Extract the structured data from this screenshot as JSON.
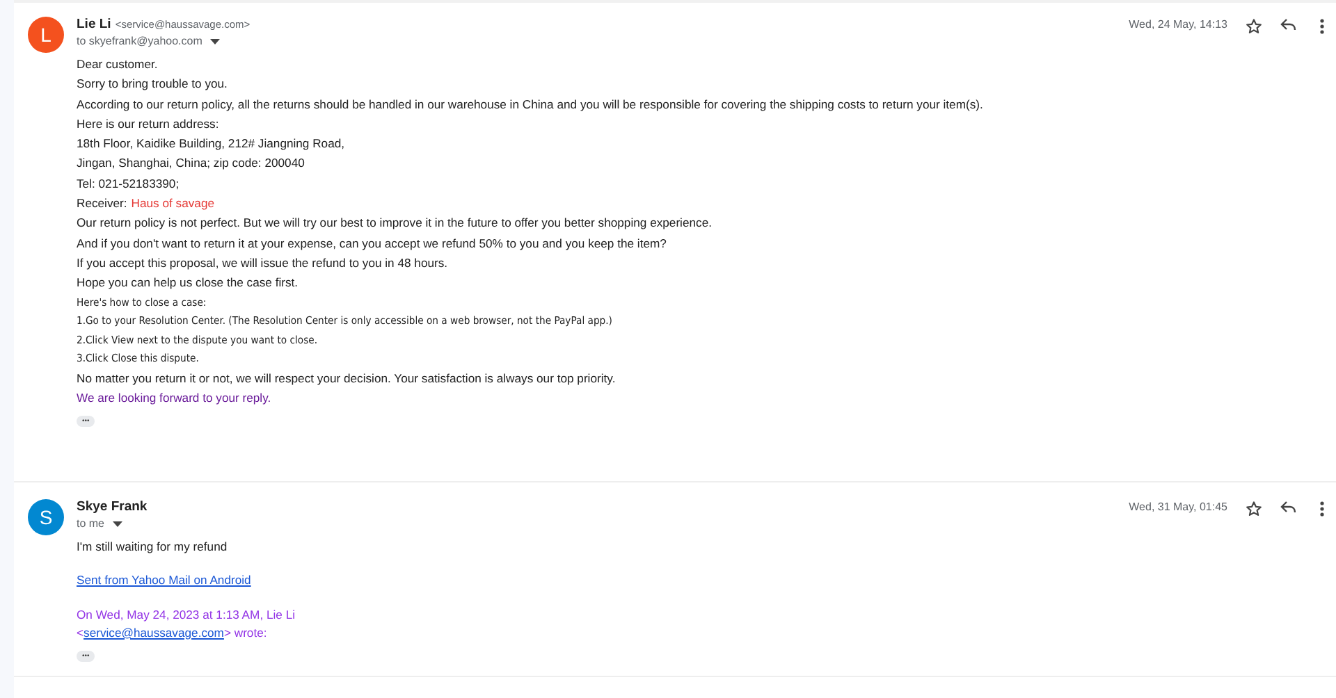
{
  "messages": [
    {
      "avatar": {
        "letter": "L",
        "color": "#f4511e"
      },
      "sender": "Lie Li",
      "email": "<service@haussavage.com>",
      "recipient": "to skyefrank@yahoo.com",
      "date": "Wed, 24 May, 14:13",
      "body": [
        {
          "kind": "text",
          "text": "Dear customer."
        },
        {
          "kind": "text",
          "text": "Sorry to bring trouble to you."
        },
        {
          "kind": "text",
          "text": "According to our return policy, all the returns should be handled in our warehouse in China and you will be responsible for covering the shipping costs to return your item(s)."
        },
        {
          "kind": "text",
          "text": "Here is our return address:"
        },
        {
          "kind": "text",
          "text": "18th Floor, Kaidike Building, 212# Jiangning Road,"
        },
        {
          "kind": "text",
          "text": "Jingan, Shanghai, China; zip code: 200040"
        },
        {
          "kind": "text",
          "text": "Tel: 021-52183390;"
        },
        {
          "kind": "labelled",
          "text": "Receiver:",
          "value": "Haus of savage"
        },
        {
          "kind": "text",
          "text": "Our return policy is not perfect. But we will try our best to improve it in the future to offer you better shopping experience."
        },
        {
          "kind": "text",
          "text": "And if you don't want to return it at your expense, can you accept we refund 50% to you and you keep the item?"
        },
        {
          "kind": "text",
          "text": "If you accept this proposal, we will issue the refund to you in 48 hours."
        },
        {
          "kind": "text",
          "text": "Hope you can help us close the case first."
        },
        {
          "kind": "small",
          "text": "Here's how to close a case:"
        },
        {
          "kind": "small",
          "text": "1.Go to your Resolution Center. (The Resolution Center is only accessible on a web browser, not the PayPal app.)"
        },
        {
          "kind": "small",
          "text": "2.Click View next to the dispute you want to close."
        },
        {
          "kind": "small",
          "text": "3.Click Close this dispute."
        },
        {
          "kind": "text",
          "text": "No matter you return it or not, we will respect your decision. Your satisfaction is always our top priority."
        },
        {
          "kind": "closing",
          "text": "We are looking forward to your reply."
        },
        {
          "kind": "more",
          "text": "•••"
        }
      ]
    },
    {
      "avatar": {
        "letter": "S",
        "color": "#0288d1"
      },
      "sender": "Skye Frank",
      "recipient": "to me",
      "date": "Wed, 31 May, 01:45",
      "body": [
        {
          "kind": "text",
          "text": "I'm still waiting for my refund"
        },
        {
          "kind": "link",
          "text": "Sent from Yahoo Mail on Android"
        },
        {
          "kind": "quote",
          "text": "On Wed, May 24, 2023 at 1:13 AM, Lie Li",
          "pre": "<",
          "link": "service@haussavage.com",
          "post": "> wrote:"
        },
        {
          "kind": "more",
          "text": "•••"
        }
      ]
    }
  ]
}
